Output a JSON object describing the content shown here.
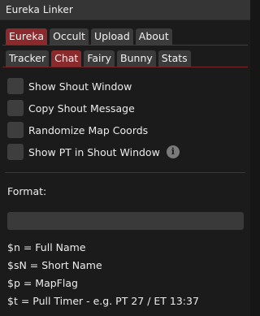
{
  "window": {
    "title": "Eureka Linker"
  },
  "main_tabs": [
    {
      "label": "Eureka",
      "active": true
    },
    {
      "label": "Occult",
      "active": false
    },
    {
      "label": "Upload",
      "active": false
    },
    {
      "label": "About",
      "active": false
    }
  ],
  "sub_tabs": [
    {
      "label": "Tracker",
      "active": false
    },
    {
      "label": "Chat",
      "active": true
    },
    {
      "label": "Fairy",
      "active": false
    },
    {
      "label": "Bunny",
      "active": false
    },
    {
      "label": "Stats",
      "active": false
    }
  ],
  "options": [
    {
      "label": "Show Shout Window",
      "checked": false
    },
    {
      "label": "Copy Shout Message",
      "checked": false
    },
    {
      "label": "Randomize Map Coords",
      "checked": false
    },
    {
      "label": "Show PT in Shout Window",
      "checked": false,
      "info_icon": "i"
    }
  ],
  "format": {
    "label": "Format:",
    "value": ""
  },
  "help": [
    "$n = Full Name",
    "$sN = Short Name",
    "$p = MapFlag",
    "$t = Pull Timer - e.g. PT 27 / ET 13:37"
  ],
  "colors": {
    "accent": "#8a2a2d",
    "tab": "#3b3b3b",
    "checkbox": "#3e3e3e",
    "background": "#1b1b1b",
    "titlebar": "#353535"
  }
}
